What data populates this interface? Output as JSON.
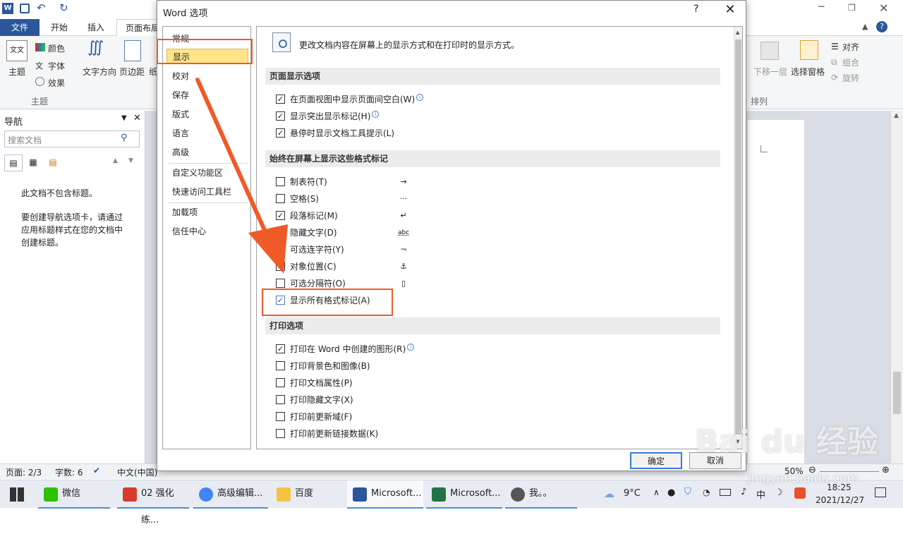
{
  "word": {
    "tabs": [
      "文件",
      "开始",
      "插入",
      "页面布局"
    ],
    "ribbon_left": {
      "theme": "主题",
      "colors": "颜色",
      "fonts": "字体",
      "effects": "效果",
      "text_dir": "文字方向",
      "margins": "页边距",
      "paper_partial": "纸"
    },
    "ribbon_right": {
      "move_down": "下移一层",
      "selection_pane": "选择窗格",
      "align": "对齐",
      "group": "组合",
      "rotate": "旋转",
      "arrange_group": "排列"
    },
    "group_theme": "主题",
    "nav": {
      "title": "导航",
      "search_placeholder": "搜索文档",
      "no_headings": "此文档不包含标题。",
      "hint": "要创建导航选项卡，请通过应用标题样式在您的文档中创建标题。"
    },
    "status": {
      "page": "页面: 2/3",
      "words": "字数: 6",
      "lang": "中文(中国)",
      "zoom": "50%"
    }
  },
  "dialog": {
    "title": "Word 选项",
    "help": "?",
    "close": "✕",
    "categories": [
      "常规",
      "显示",
      "校对",
      "保存",
      "版式",
      "语言",
      "高级",
      "自定义功能区",
      "快速访问工具栏",
      "加载项",
      "信任中心"
    ],
    "selected_category": "显示",
    "intro": "更改文档内容在屏幕上的显示方式和在打印时的显示方式。",
    "sections": {
      "page_display": {
        "title": "页面显示选项",
        "options": [
          {
            "label": "在页面视图中显示页面间空白(W)",
            "checked": true,
            "info": true
          },
          {
            "label": "显示突出显示标记(H)",
            "checked": true,
            "info": true
          },
          {
            "label": "悬停时显示文档工具提示(L)",
            "checked": true,
            "info": false
          }
        ]
      },
      "format_marks": {
        "title": "始终在屏幕上显示这些格式标记",
        "options": [
          {
            "label": "制表符(T)",
            "checked": false,
            "symbol": "→"
          },
          {
            "label": "空格(S)",
            "checked": false,
            "symbol": "···"
          },
          {
            "label": "段落标记(M)",
            "checked": true,
            "symbol": "↵"
          },
          {
            "label": "隐藏文字(D)",
            "checked": false,
            "symbol": "abc"
          },
          {
            "label": "可选连字符(Y)",
            "checked": false,
            "symbol": "¬"
          },
          {
            "label": "对象位置(C)",
            "checked": false,
            "symbol": "⚓"
          },
          {
            "label": "可选分隔符(O)",
            "checked": false,
            "symbol": "▯"
          },
          {
            "label": "显示所有格式标记(A)",
            "checked": true,
            "symbol": ""
          }
        ]
      },
      "print": {
        "title": "打印选项",
        "options": [
          {
            "label": "打印在 Word 中创建的图形(R)",
            "checked": true,
            "info": true
          },
          {
            "label": "打印背景色和图像(B)",
            "checked": false
          },
          {
            "label": "打印文档属性(P)",
            "checked": false
          },
          {
            "label": "打印隐藏文字(X)",
            "checked": false
          },
          {
            "label": "打印前更新域(F)",
            "checked": false
          },
          {
            "label": "打印前更新链接数据(K)",
            "checked": false
          }
        ]
      }
    },
    "ok": "确定",
    "cancel": "取消"
  },
  "taskbar": {
    "apps": [
      {
        "label": "微信",
        "color": "#2dc100"
      },
      {
        "label": "02 强化练...",
        "color": "#d93b2b"
      },
      {
        "label": "高级编辑...",
        "color": "#4285f4"
      },
      {
        "label": "百度",
        "color": "#f5c242"
      },
      {
        "label": "Microsoft...",
        "color": "#2b579a"
      },
      {
        "label": "Microsoft...",
        "color": "#217346"
      },
      {
        "label": "我。。",
        "color": "#555555"
      }
    ],
    "weather": "9°C",
    "ime": "中",
    "time": "18:25",
    "date": "2021/12/27"
  },
  "watermark": {
    "logo": "Bai du 经验",
    "url": "jingyan.baidu.com"
  },
  "colors": {
    "accent": "#2b579a",
    "highlight": "#ffe58a",
    "annotation": "#f05a28"
  }
}
